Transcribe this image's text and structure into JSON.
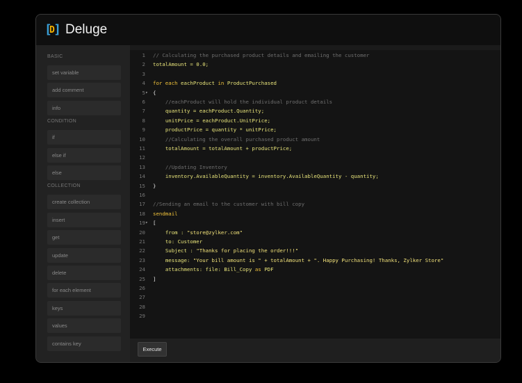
{
  "app": {
    "title": "Deluge"
  },
  "icons": {
    "logo": "deluge-logo-icon",
    "fold": "fold-arrow-icon"
  },
  "colors": {
    "accent_blue": "#3aa0d8",
    "accent_yellow": "#f0b000",
    "keyword": "#f0c23a",
    "variable": "#e8e47a",
    "comment": "#6f6f6f"
  },
  "sidebar": {
    "sections": [
      {
        "title": "BASIC",
        "items": [
          "set variable",
          "add comment",
          "info"
        ]
      },
      {
        "title": "CONDITION",
        "items": [
          "if",
          "else if",
          "else"
        ]
      },
      {
        "title": "COLLECTION",
        "items": [
          "create collection",
          "insert",
          "get",
          "update",
          "delete",
          "for each element",
          "keys",
          "values",
          "contains key"
        ]
      }
    ]
  },
  "editor": {
    "lines": [
      {
        "n": "1",
        "fold": false,
        "tokens": [
          [
            "cm",
            "// Calculating the purchased product details and emailing the customer"
          ]
        ]
      },
      {
        "n": "2",
        "fold": false,
        "tokens": [
          [
            "var",
            "totalAmount = 0.0;"
          ]
        ]
      },
      {
        "n": "3",
        "fold": false,
        "tokens": []
      },
      {
        "n": "4",
        "fold": false,
        "tokens": [
          [
            "kw",
            "for each "
          ],
          [
            "var",
            "eachProduct "
          ],
          [
            "kw",
            "in "
          ],
          [
            "var",
            "ProductPurchased"
          ]
        ]
      },
      {
        "n": "5",
        "fold": true,
        "tokens": [
          [
            "pl",
            "{"
          ]
        ]
      },
      {
        "n": "6",
        "fold": false,
        "tokens": [
          [
            "pl",
            "    "
          ],
          [
            "cm",
            "//eachProduct will hold the individual product details"
          ]
        ]
      },
      {
        "n": "7",
        "fold": false,
        "tokens": [
          [
            "pl",
            "    "
          ],
          [
            "var",
            "quantity = eachProduct.Quantity;"
          ]
        ]
      },
      {
        "n": "8",
        "fold": false,
        "tokens": [
          [
            "pl",
            "    "
          ],
          [
            "var",
            "unitPrice = eachProduct.UnitPrice;"
          ]
        ]
      },
      {
        "n": "9",
        "fold": false,
        "tokens": [
          [
            "pl",
            "    "
          ],
          [
            "var",
            "productPrice = quantity * unitPrice;"
          ]
        ]
      },
      {
        "n": "10",
        "fold": false,
        "tokens": [
          [
            "pl",
            "    "
          ],
          [
            "cm",
            "//Calculating the overall purchased product amount"
          ]
        ]
      },
      {
        "n": "11",
        "fold": false,
        "tokens": [
          [
            "pl",
            "    "
          ],
          [
            "var",
            "totalAmount = totalAmount + productPrice;"
          ]
        ]
      },
      {
        "n": "12",
        "fold": false,
        "tokens": []
      },
      {
        "n": "13",
        "fold": false,
        "tokens": [
          [
            "pl",
            "    "
          ],
          [
            "cm",
            "//Updating Inventory"
          ]
        ]
      },
      {
        "n": "14",
        "fold": false,
        "tokens": [
          [
            "pl",
            "    "
          ],
          [
            "var",
            "inventory.AvailableQuantity = inventory.AvailableQuantity - quantity;"
          ]
        ]
      },
      {
        "n": "15",
        "fold": false,
        "tokens": [
          [
            "pl",
            "}"
          ]
        ]
      },
      {
        "n": "16",
        "fold": false,
        "tokens": []
      },
      {
        "n": "17",
        "fold": false,
        "tokens": [
          [
            "cm",
            "//Sending an email to the customer with bill copy"
          ]
        ]
      },
      {
        "n": "18",
        "fold": false,
        "tokens": [
          [
            "kw",
            "sendmail"
          ]
        ]
      },
      {
        "n": "19",
        "fold": true,
        "tokens": [
          [
            "pl",
            "["
          ]
        ]
      },
      {
        "n": "20",
        "fold": false,
        "tokens": [
          [
            "pl",
            "    "
          ],
          [
            "ob",
            "from : "
          ],
          [
            "str",
            "\"store@zylker.com\""
          ]
        ]
      },
      {
        "n": "21",
        "fold": false,
        "tokens": [
          [
            "pl",
            "    "
          ],
          [
            "ob",
            "to: Customer"
          ]
        ]
      },
      {
        "n": "22",
        "fold": false,
        "tokens": [
          [
            "pl",
            "    "
          ],
          [
            "ob",
            "Subject : "
          ],
          [
            "str",
            "\"Thanks for placing the order!!!\""
          ]
        ]
      },
      {
        "n": "23",
        "fold": false,
        "tokens": [
          [
            "pl",
            "    "
          ],
          [
            "ob",
            "message: "
          ],
          [
            "str",
            "\"Your bill amount is \" + totalAmount + \". Happy Purchasing! Thanks, Zylker Store\""
          ]
        ]
      },
      {
        "n": "24",
        "fold": false,
        "tokens": [
          [
            "pl",
            "    "
          ],
          [
            "ob",
            "attachments: file: Bill_Copy "
          ],
          [
            "kw",
            "as "
          ],
          [
            "ob",
            "PDF"
          ]
        ]
      },
      {
        "n": "25",
        "fold": false,
        "tokens": [
          [
            "pl",
            "]"
          ]
        ]
      },
      {
        "n": "26",
        "fold": false,
        "tokens": []
      },
      {
        "n": "27",
        "fold": false,
        "tokens": []
      },
      {
        "n": "28",
        "fold": false,
        "tokens": []
      },
      {
        "n": "29",
        "fold": false,
        "tokens": []
      }
    ]
  },
  "footer": {
    "execute_label": "Execute"
  }
}
